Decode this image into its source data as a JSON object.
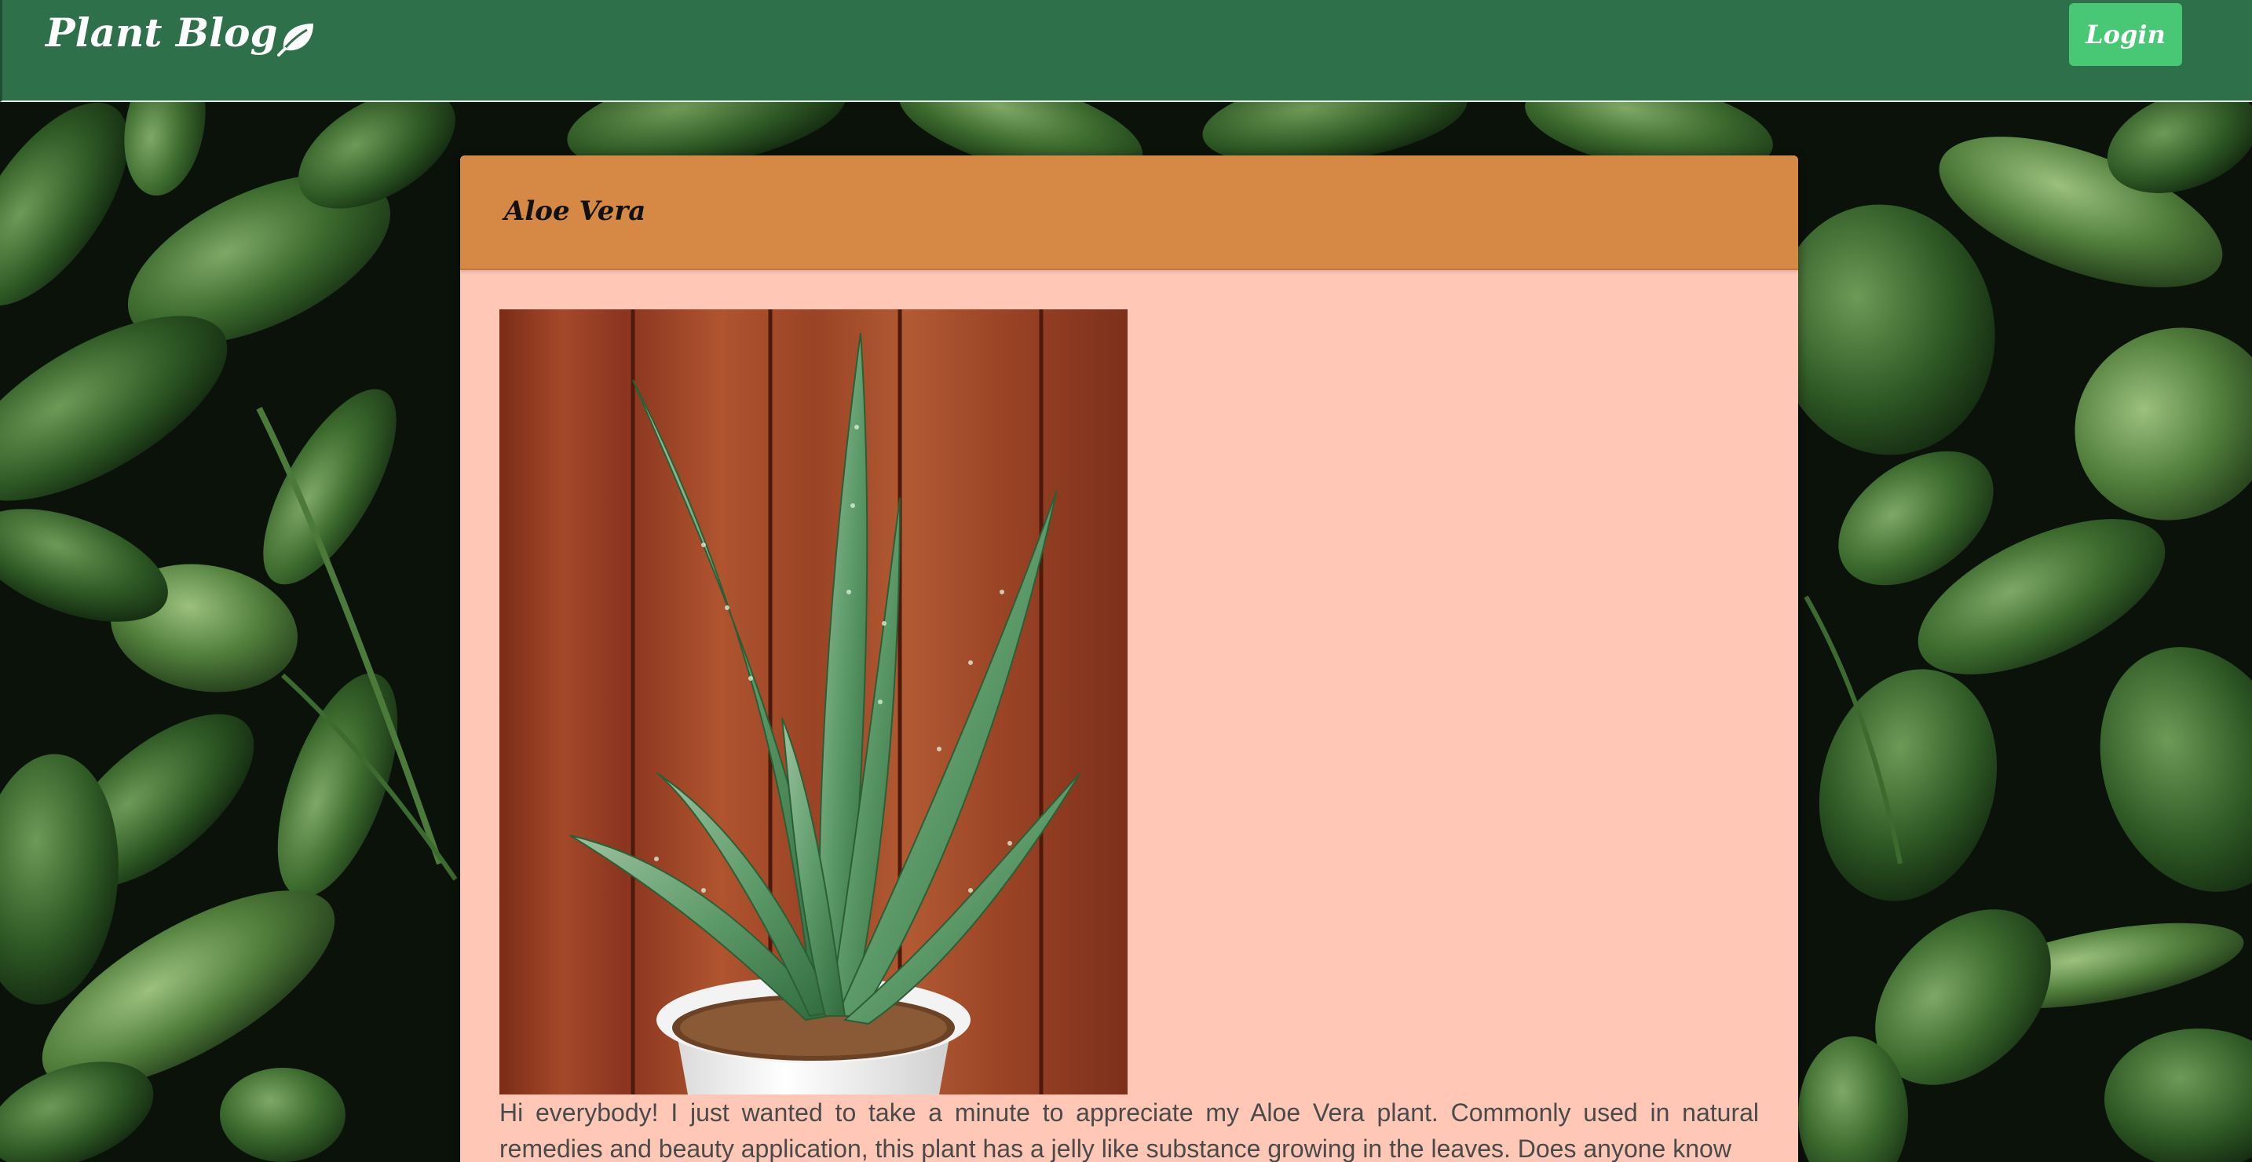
{
  "navbar": {
    "brand": "Plant Blog",
    "brand_icon": "leaf-icon",
    "login_label": "Login",
    "color": "#2e7049",
    "login_color": "#48c774"
  },
  "post": {
    "title": "Aloe Vera",
    "header_color": "#d68945",
    "card_color": "#ffc8b6",
    "image": "aloe-vera-plant-photo",
    "body": "Hi everybody! I just wanted to take a minute to appreciate my Aloe Vera plant. Commonly used in natural remedies and beauty application, this plant has a jelly like substance growing in the leaves. Does anyone know"
  },
  "background": {
    "image": "green-leaves-background"
  }
}
